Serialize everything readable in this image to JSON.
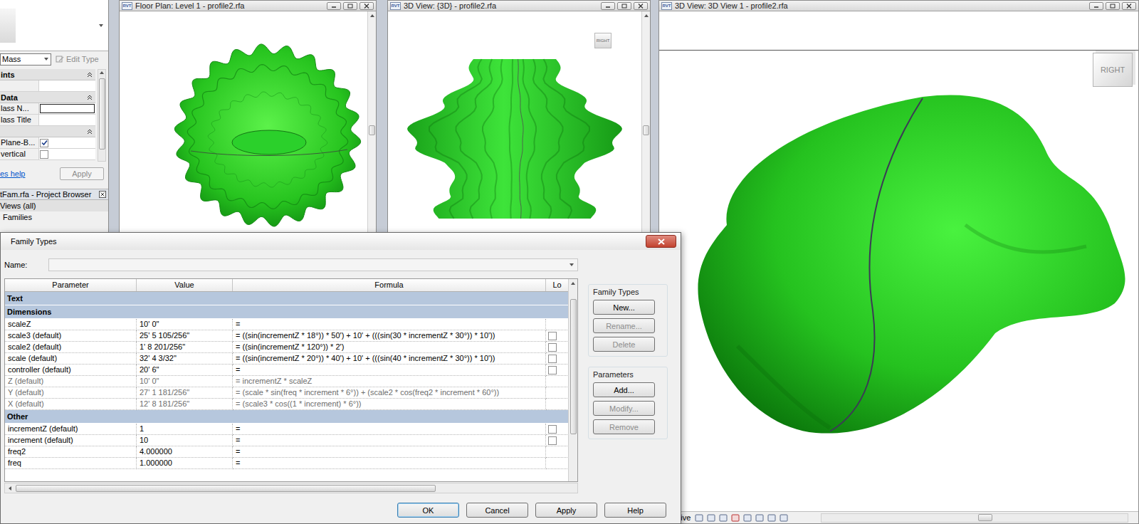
{
  "app_icon_label": "RVT",
  "palette": {
    "type_selector": "Mass",
    "edit_type": {
      "label": "Edit Type",
      "disabled": true
    },
    "rows": [
      {
        "kind": "header",
        "label": "ints",
        "value": "",
        "checked": false
      },
      {
        "kind": "field",
        "label": "",
        "value": "",
        "checked": false
      },
      {
        "kind": "header",
        "label": "Data",
        "value": "",
        "checked": false
      },
      {
        "kind": "input",
        "label": "lass N...",
        "value": "",
        "checked": false
      },
      {
        "kind": "field",
        "label": "lass Title",
        "value": "",
        "checked": false
      },
      {
        "kind": "header",
        "label": "",
        "value": "",
        "checked": false
      },
      {
        "kind": "check",
        "label": "Plane-B...",
        "value": "",
        "checked": true
      },
      {
        "kind": "check",
        "label": "vertical",
        "value": "",
        "checked": false
      }
    ],
    "help_link": "es help",
    "apply": {
      "label": "Apply",
      "disabled": true
    }
  },
  "project_browser": {
    "title": "tFam.rfa - Project Browser",
    "items": [
      {
        "label": "Views (all)",
        "selected": true
      },
      {
        "label": "Families",
        "selected": false
      }
    ]
  },
  "views": [
    {
      "title": "Floor Plan: Level 1 - profile2.rfa",
      "kind": "plan",
      "viewcube": ""
    },
    {
      "title": "3D View: {3D} - profile2.rfa",
      "kind": "vase",
      "viewcube": "RIGHT"
    },
    {
      "title": "3D View: 3D View 1 - profile2.rfa",
      "kind": "blob",
      "viewcube": "RIGHT"
    }
  ],
  "status_bar": {
    "text": "spective"
  },
  "dialog": {
    "title": "Family Types",
    "name_label": "Name:",
    "name_value": "",
    "columns": [
      "Parameter",
      "Value",
      "Formula",
      "Lo"
    ],
    "rows": [
      {
        "kind": "group",
        "name": "Text",
        "value": "",
        "formula": "",
        "lockable": false,
        "locked": false,
        "greyed": false
      },
      {
        "kind": "group",
        "name": "Dimensions",
        "value": "",
        "formula": "",
        "lockable": false,
        "locked": false,
        "greyed": false
      },
      {
        "kind": "param",
        "name": "scaleZ",
        "value": "10'  0\"",
        "formula": "=",
        "lockable": false,
        "locked": false,
        "greyed": false
      },
      {
        "kind": "param",
        "name": "scale3 (default)",
        "value": "25'  5 105/256\"",
        "formula": "= ((sin(incrementZ * 18°)) * 50') + 10' + (((sin(30 * incrementZ * 30°)) * 10'))",
        "lockable": true,
        "locked": false,
        "greyed": false
      },
      {
        "kind": "param",
        "name": "scale2 (default)",
        "value": "1'  8 201/256\"",
        "formula": "= ((sin(incrementZ * 120°)) * 2')",
        "lockable": true,
        "locked": false,
        "greyed": false
      },
      {
        "kind": "param",
        "name": "scale (default)",
        "value": "32'  4 3/32\"",
        "formula": "= ((sin(incrementZ * 20°)) * 40') + 10' + (((sin(40 * incrementZ * 30°)) * 10'))",
        "lockable": true,
        "locked": false,
        "greyed": false
      },
      {
        "kind": "param",
        "name": "controller (default)",
        "value": "20'  6\"",
        "formula": "=",
        "lockable": true,
        "locked": false,
        "greyed": false
      },
      {
        "kind": "param",
        "name": "Z (default)",
        "value": "10'  0\"",
        "formula": "= incrementZ * scaleZ",
        "lockable": false,
        "locked": false,
        "greyed": true
      },
      {
        "kind": "param",
        "name": "Y (default)",
        "value": "27'  1 181/256\"",
        "formula": "= (scale * sin(freq * increment * 6°)) + (scale2 * cos(freq2 * increment * 60°))",
        "lockable": false,
        "locked": false,
        "greyed": true
      },
      {
        "kind": "param",
        "name": "X (default)",
        "value": "12'  8 181/256\"",
        "formula": "= (scale3 * cos((1 * increment) * 6°))",
        "lockable": false,
        "locked": false,
        "greyed": true
      },
      {
        "kind": "group",
        "name": "Other",
        "value": "",
        "formula": "",
        "lockable": false,
        "locked": false,
        "greyed": false
      },
      {
        "kind": "param",
        "name": "incrementZ (default)",
        "value": "1",
        "formula": "=",
        "lockable": true,
        "locked": false,
        "greyed": false
      },
      {
        "kind": "param",
        "name": "increment (default)",
        "value": "10",
        "formula": "=",
        "lockable": true,
        "locked": false,
        "greyed": false
      },
      {
        "kind": "param",
        "name": "freq2",
        "value": "4.000000",
        "formula": "=",
        "lockable": false,
        "locked": false,
        "greyed": false
      },
      {
        "kind": "param",
        "name": "freq",
        "value": "1.000000",
        "formula": "=",
        "lockable": false,
        "locked": false,
        "greyed": false
      }
    ],
    "side_groups": [
      {
        "label": "Family Types",
        "buttons": [
          {
            "label": "New...",
            "disabled": false
          },
          {
            "label": "Rename...",
            "disabled": true
          },
          {
            "label": "Delete",
            "disabled": true
          }
        ]
      },
      {
        "label": "Parameters",
        "buttons": [
          {
            "label": "Add...",
            "disabled": false
          },
          {
            "label": "Modify...",
            "disabled": true
          },
          {
            "label": "Remove",
            "disabled": true
          }
        ]
      }
    ],
    "footer_buttons": [
      {
        "label": "OK",
        "selected": true
      },
      {
        "label": "Cancel",
        "selected": false
      },
      {
        "label": "Apply",
        "selected": false
      },
      {
        "label": "Help",
        "selected": false
      }
    ]
  }
}
